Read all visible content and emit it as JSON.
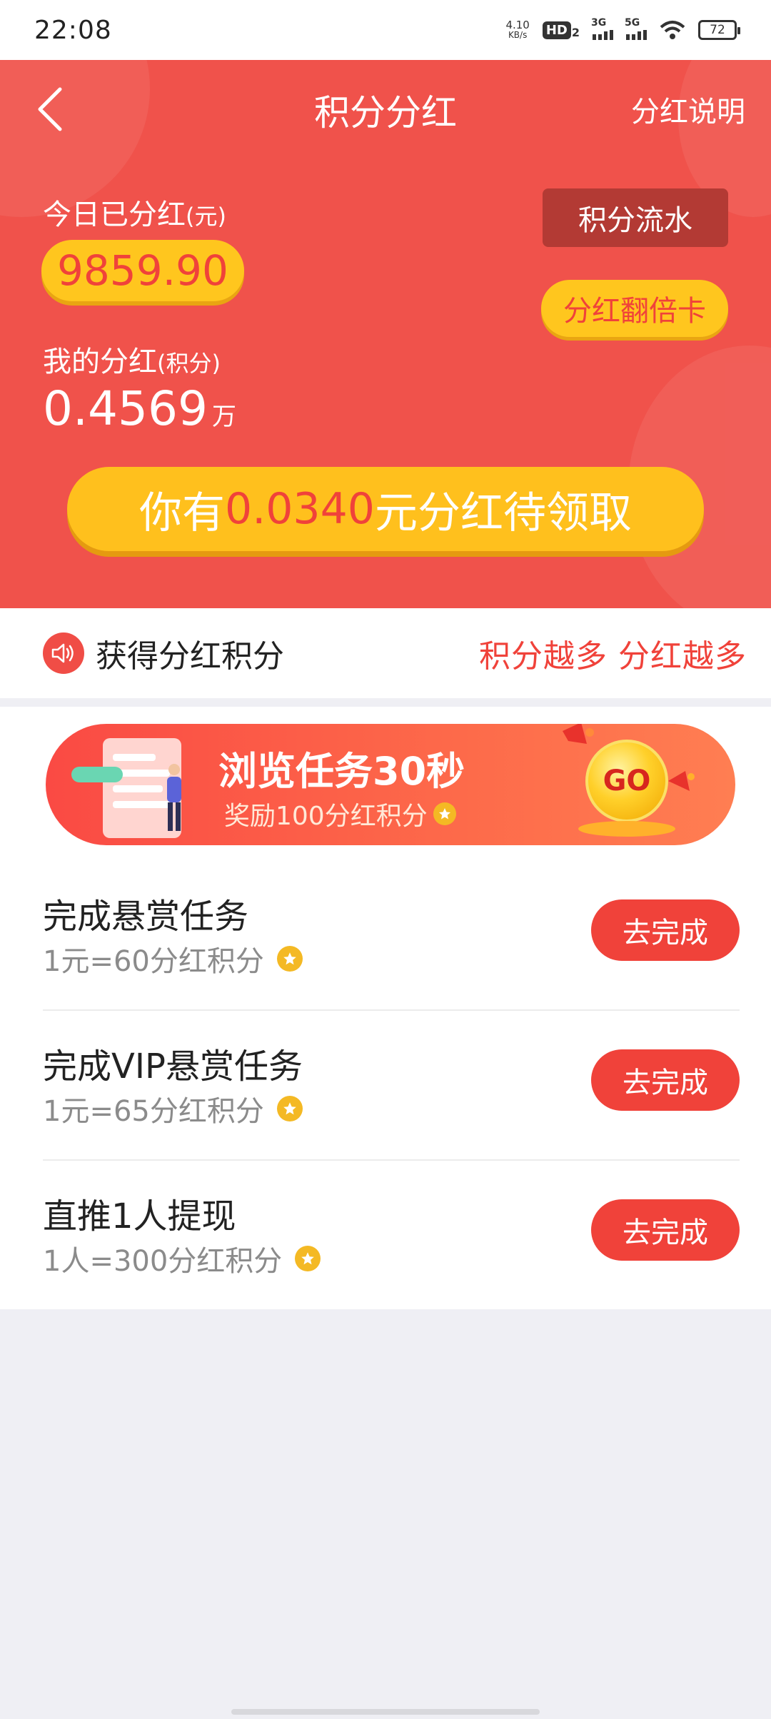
{
  "status_bar": {
    "time": "22:08",
    "net_speed_value": "4.10",
    "net_speed_unit": "KB/s",
    "hd_label": "HD",
    "hd_sub": "2",
    "signal_1_label": "3G",
    "signal_2_label": "5G",
    "battery": "72"
  },
  "nav": {
    "title": "积分分红",
    "right_label": "分红说明"
  },
  "summary": {
    "today_label": "今日已分红",
    "today_unit": "(元)",
    "today_value": "9859.90",
    "flow_button": "积分流水",
    "double_card_button": "分红翻倍卡",
    "my_label": "我的分红",
    "my_unit": "(积分)",
    "my_value": "0.4569",
    "my_value_unit": "万"
  },
  "claim": {
    "prefix": "你有",
    "amount": "0.0340",
    "suffix": "元分红待领取"
  },
  "notice": {
    "text": "获得分红积分",
    "slogan": "积分越多 分红越多"
  },
  "banner": {
    "title": "浏览任务30秒",
    "subtitle": "奖励100分红积分",
    "go_label": "GO"
  },
  "tasks": [
    {
      "title": "完成悬赏任务",
      "subtitle": "1元=60分红积分",
      "button": "去完成"
    },
    {
      "title": "完成VIP悬赏任务",
      "subtitle": "1元=65分红积分",
      "button": "去完成"
    },
    {
      "title": "直推1人提现",
      "subtitle": "1人=300分红积分",
      "button": "去完成"
    }
  ],
  "colors": {
    "header_red": "#f0524b",
    "accent_yellow": "#ffc61e",
    "button_red": "#f0423a"
  }
}
